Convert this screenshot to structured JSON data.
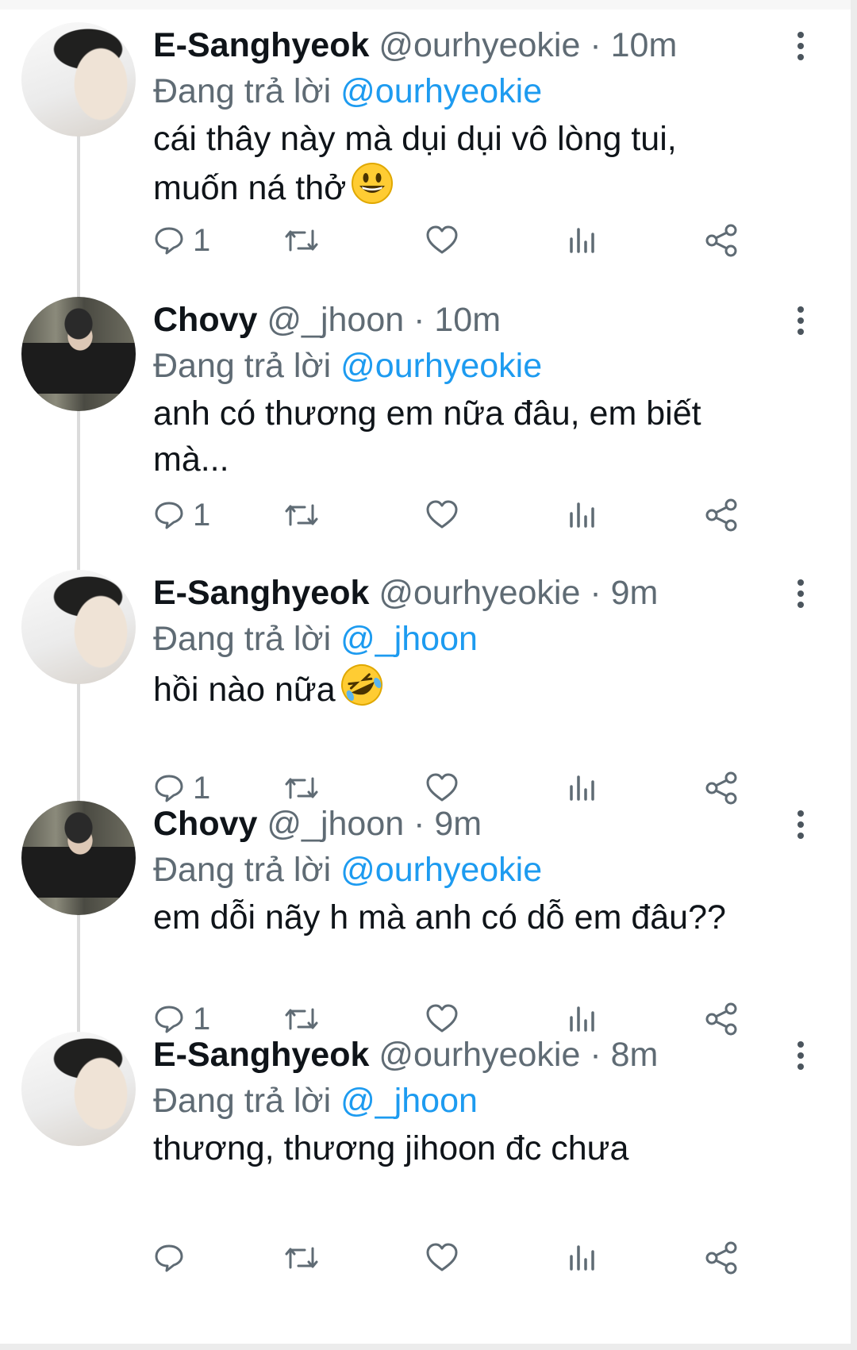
{
  "replying_label": "Đang trả lời",
  "tweets": [
    {
      "display_name": "E-Sanghyeok",
      "handle": "@ourhyeokie",
      "separator": "·",
      "time": "10m",
      "replying_to": "@ourhyeokie",
      "text_line1": "cái thây này mà dụi dụi vô lòng tui,",
      "text_line2": "muốn ná thở",
      "emoji": "grinning-face",
      "reply_count": "1"
    },
    {
      "display_name": "Chovy",
      "handle": "@_jhoon",
      "separator": "·",
      "time": "10m",
      "replying_to": "@ourhyeokie",
      "text_line1": "anh có thương em nữa đâu, em biết",
      "text_line2": "mà...",
      "reply_count": "1"
    },
    {
      "display_name": "E-Sanghyeok",
      "handle": "@ourhyeokie",
      "separator": "·",
      "time": "9m",
      "replying_to": "@_jhoon",
      "text_line1": "hồi nào nữa",
      "emoji": "rolling-on-floor-laughing",
      "reply_count": "1"
    },
    {
      "display_name": "Chovy",
      "handle": "@_jhoon",
      "separator": "·",
      "time": "9m",
      "replying_to": "@ourhyeokie",
      "text_line1": "em dỗi nãy h mà anh có dỗ em đâu??",
      "reply_count": "1"
    },
    {
      "display_name": "E-Sanghyeok",
      "handle": "@ourhyeokie",
      "separator": "·",
      "time": "8m",
      "replying_to": "@_jhoon",
      "text_line1": "thương, thương jihoon đc chưa",
      "reply_count": ""
    }
  ],
  "icons": {
    "reply": "reply-icon",
    "retweet": "retweet-icon",
    "like": "heart-icon",
    "analytics": "analytics-icon",
    "share": "share-icon",
    "more": "more-vertical-icon"
  },
  "colors": {
    "mention": "#1d9bf0",
    "secondary_text": "#5f6b74",
    "thread_line": "#dbdbdb"
  }
}
